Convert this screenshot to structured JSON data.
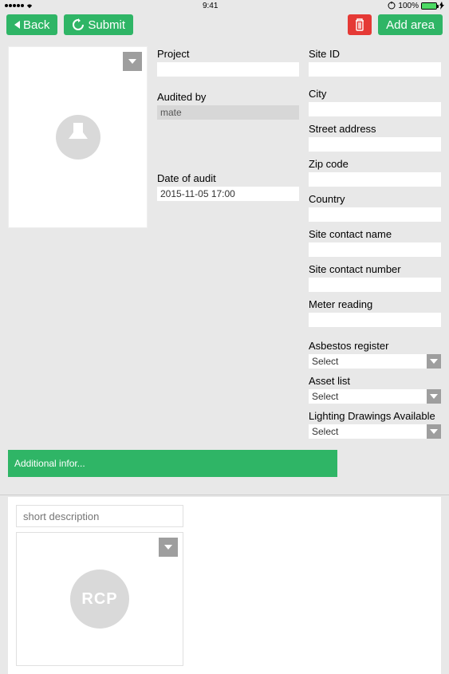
{
  "status": {
    "carrier_dots": 5,
    "time": "9:41",
    "battery_pct": "100%",
    "signal_glyph": "•••••",
    "wifi_glyph": "ᯤ"
  },
  "toolbar": {
    "back_label": "Back",
    "submit_label": "Submit",
    "add_area_label": "Add area"
  },
  "form": {
    "project_label": "Project",
    "project_value": "",
    "audited_by_label": "Audited by",
    "audited_by_value": "mate",
    "date_label": "Date of audit",
    "date_value": "2015-11-05 17:00",
    "site_id_label": "Site ID",
    "site_id_value": "",
    "city_label": "City",
    "city_value": "",
    "street_label": "Street address",
    "street_value": "",
    "zip_label": "Zip code",
    "zip_value": "",
    "country_label": "Country",
    "country_value": "",
    "contact_name_label": "Site contact name",
    "contact_name_value": "",
    "contact_number_label": "Site contact number",
    "contact_number_value": "",
    "meter_label": "Meter reading",
    "meter_value": "",
    "asbestos_label": "Asbestos register",
    "asbestos_value": "Select",
    "asset_list_label": "Asset list",
    "asset_list_value": "Select",
    "lighting_label": "Lighting Drawings Available",
    "lighting_value": "Select"
  },
  "additional_info_label": "Additional infor...",
  "bottom": {
    "short_desc_placeholder": "short description",
    "rcp_label": "RCP"
  },
  "colors": {
    "accent": "#2fb566",
    "danger": "#e53935",
    "bg": "#e8e8e8",
    "muted": "#9e9e9e"
  }
}
